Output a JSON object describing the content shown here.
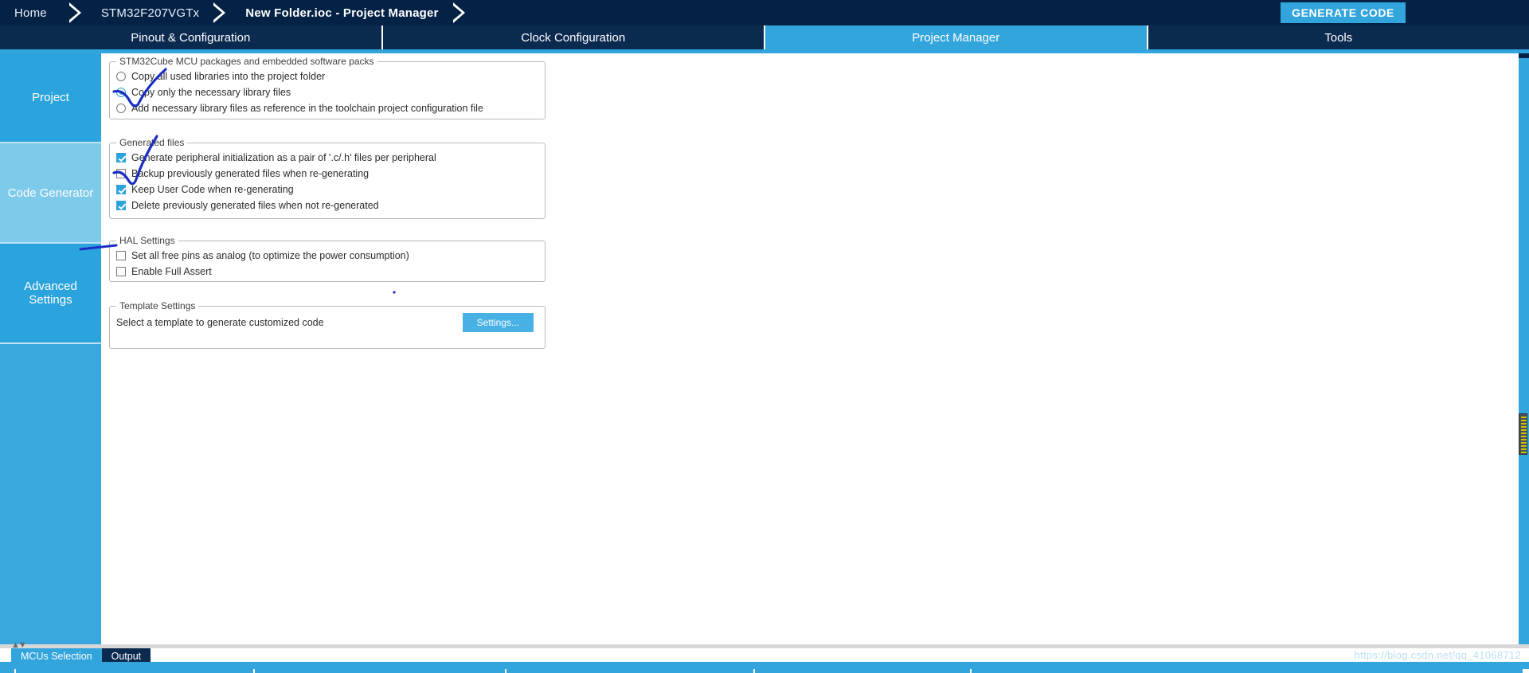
{
  "topbar": {
    "breadcrumbs": [
      {
        "label": "Home",
        "active": false
      },
      {
        "label": "STM32F207VGTx",
        "active": false
      },
      {
        "label": "New Folder.ioc - Project Manager",
        "active": true
      }
    ],
    "generate_code_label": "GENERATE CODE",
    "background_color": "#042246",
    "accent_color": "#33a5dd"
  },
  "tabs": [
    {
      "label": "Pinout & Configuration",
      "active": false
    },
    {
      "label": "Clock Configuration",
      "active": false
    },
    {
      "label": "Project Manager",
      "active": true
    },
    {
      "label": "Tools",
      "active": false
    }
  ],
  "sidebar": {
    "items": [
      {
        "label": "Project",
        "selected": false
      },
      {
        "label": "Code Generator",
        "selected": true
      },
      {
        "label": "Advanced Settings",
        "selected": false
      }
    ]
  },
  "groups": {
    "packs": {
      "title": "STM32Cube MCU packages and embedded software packs",
      "options": [
        {
          "label": "Copy all used libraries into the project folder",
          "checked": false
        },
        {
          "label": "Copy only the necessary library files",
          "checked": true
        },
        {
          "label": "Add necessary library files as reference in the toolchain project configuration file",
          "checked": false
        }
      ]
    },
    "generated_files": {
      "title": "Generated files",
      "options": [
        {
          "label": "Generate peripheral initialization as a pair of '.c/.h' files per peripheral",
          "checked": true
        },
        {
          "label": "Backup previously generated files when re-generating",
          "checked": false
        },
        {
          "label": "Keep User Code when re-generating",
          "checked": true
        },
        {
          "label": "Delete previously generated files when not re-generated",
          "checked": true
        }
      ]
    },
    "hal_settings": {
      "title": "HAL Settings",
      "options": [
        {
          "label": "Set all free pins as analog (to optimize the power consumption)",
          "checked": false
        },
        {
          "label": "Enable Full Assert",
          "checked": false
        }
      ]
    },
    "template_settings": {
      "title": "Template Settings",
      "description": "Select a template to generate customized code",
      "settings_button_label": "Settings..."
    }
  },
  "bottom": {
    "tabs": [
      {
        "label": "MCUs Selection",
        "active": true
      },
      {
        "label": "Output",
        "active": false
      }
    ]
  },
  "watermark": "https://blog.csdn.net/qq_41068712",
  "annotations": {
    "color": "#1a2ec4",
    "marks": [
      "check-mark-over-copy-only-necessary-library-files",
      "check-mark-over-generate-peripheral-initialization",
      "underline-pointer-to-hal-settings"
    ]
  }
}
